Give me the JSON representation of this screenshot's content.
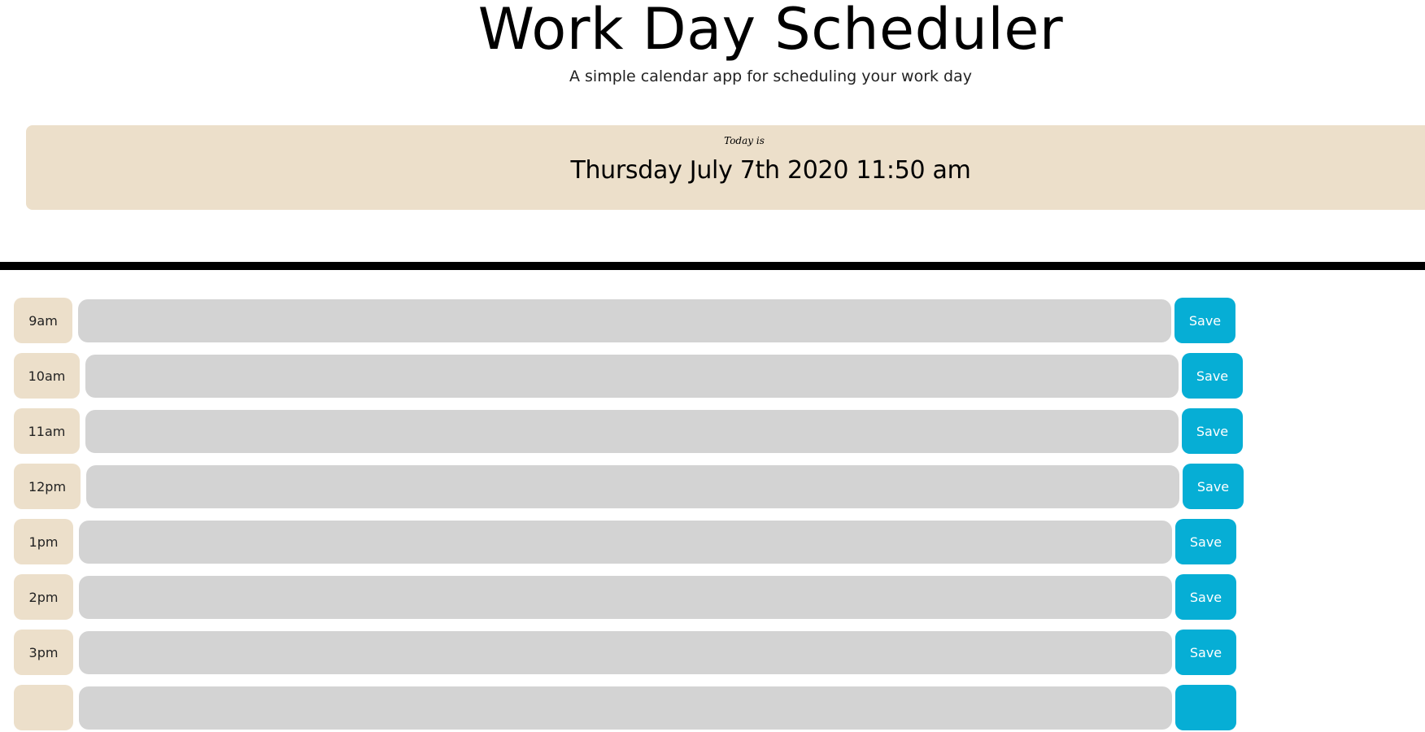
{
  "header": {
    "title": "Work Day Scheduler",
    "subtitle": "A simple calendar app for scheduling your work day"
  },
  "today": {
    "label": "Today is",
    "date": "Thursday July 7th 2020 11:50 am"
  },
  "colors": {
    "hour_bg": "#ecdfca",
    "field_bg": "#d3d3d3",
    "save_bg": "#06aed5",
    "divider": "#000000"
  },
  "rows": [
    {
      "hour": "9am",
      "text": "",
      "save_label": "Save"
    },
    {
      "hour": "10am",
      "text": "",
      "save_label": "Save"
    },
    {
      "hour": "11am",
      "text": "",
      "save_label": "Save"
    },
    {
      "hour": "12pm",
      "text": "",
      "save_label": "Save"
    },
    {
      "hour": "1pm",
      "text": "",
      "save_label": "Save"
    },
    {
      "hour": "2pm",
      "text": "",
      "save_label": "Save"
    },
    {
      "hour": "3pm",
      "text": "",
      "save_label": "Save"
    },
    {
      "hour": "",
      "text": "",
      "save_label": ""
    }
  ]
}
